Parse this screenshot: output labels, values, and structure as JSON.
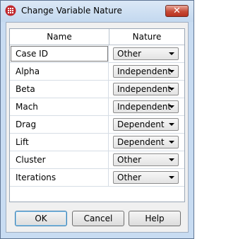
{
  "window": {
    "title": "Change Variable Nature",
    "close_symbol": "✕"
  },
  "grid": {
    "columns": [
      "Name",
      "Nature"
    ],
    "rows": [
      {
        "name": "Case ID",
        "nature": "Other",
        "selected": true
      },
      {
        "name": "Alpha",
        "nature": "Independent"
      },
      {
        "name": "Beta",
        "nature": "Independent"
      },
      {
        "name": "Mach",
        "nature": "Independent"
      },
      {
        "name": "Drag",
        "nature": "Dependent"
      },
      {
        "name": "Lift",
        "nature": "Dependent"
      },
      {
        "name": "Cluster",
        "nature": "Other"
      },
      {
        "name": "Iterations",
        "nature": "Other"
      }
    ]
  },
  "buttons": {
    "ok": "OK",
    "cancel": "Cancel",
    "help": "Help"
  },
  "colors": {
    "app_icon": "#c0282d",
    "title_bar": "#c3d8ef",
    "close_button": "#c74a36"
  }
}
